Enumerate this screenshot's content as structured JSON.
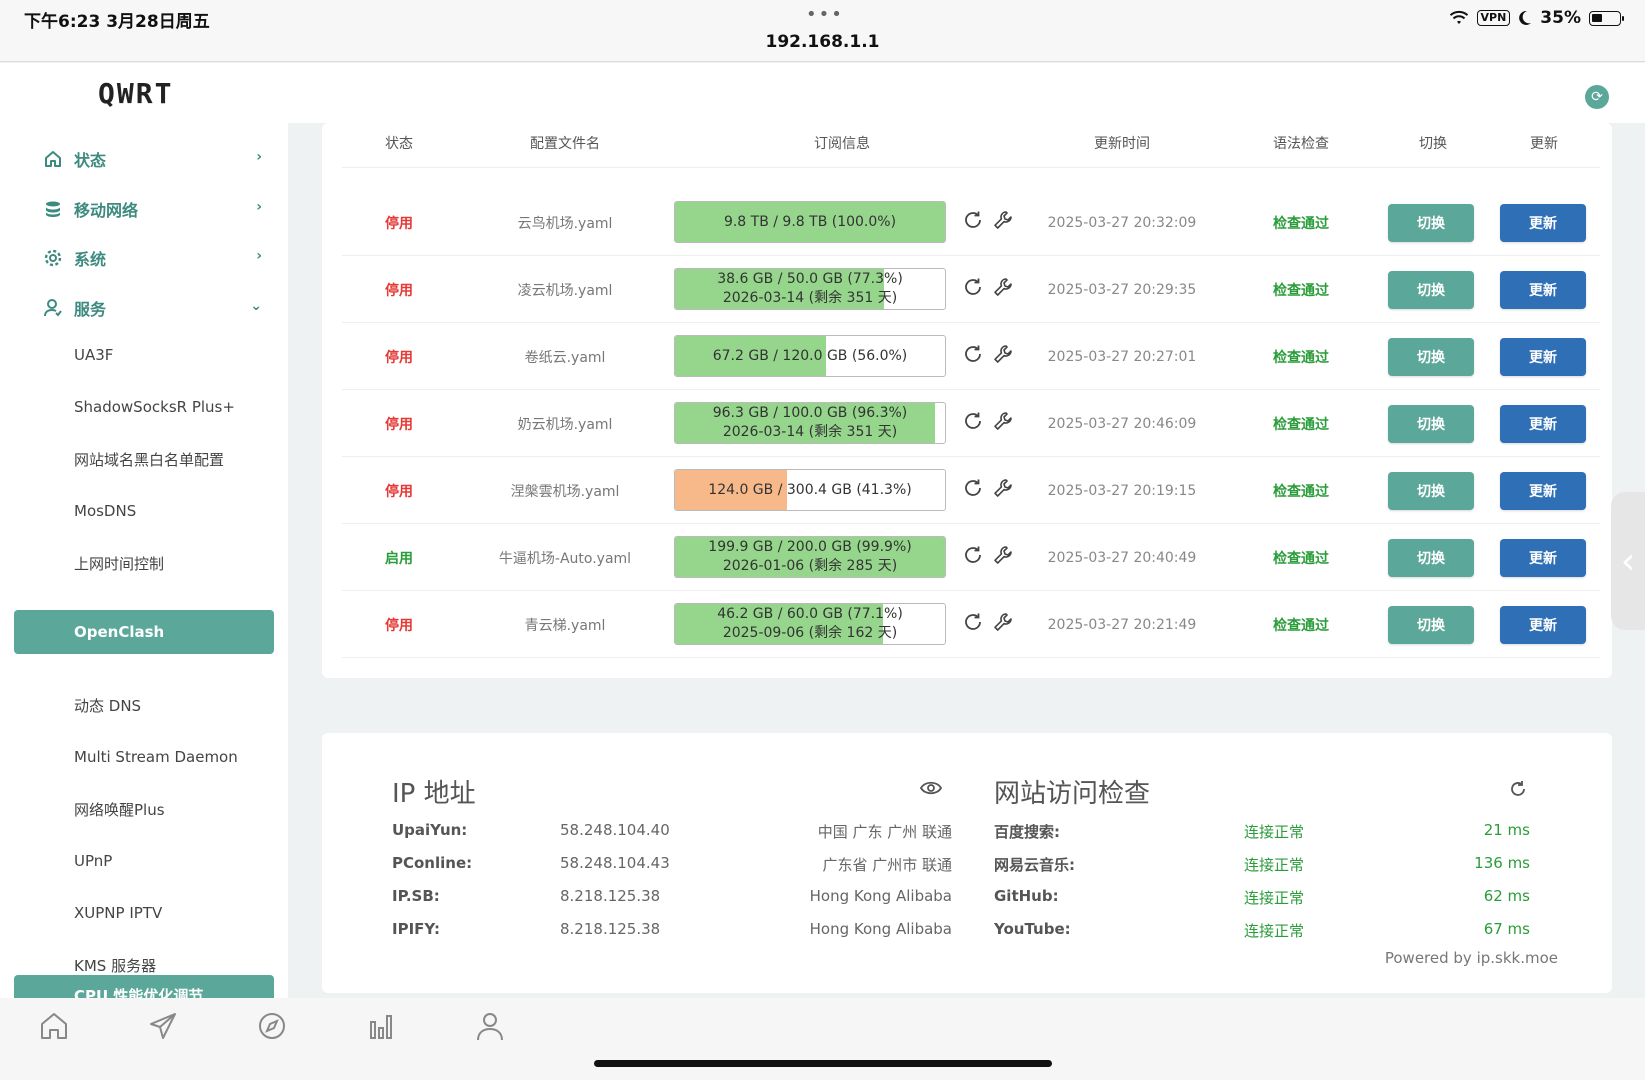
{
  "statusbar": {
    "time": "下午6:23   3月28日周五",
    "dots": "•••",
    "url": "192.168.1.1",
    "vpn": "VPN",
    "battery": "35%"
  },
  "sidebar": {
    "logo": "QWRT",
    "nav": [
      {
        "label": "状态",
        "icon": "home-icon"
      },
      {
        "label": "移动网络",
        "icon": "database-icon"
      },
      {
        "label": "系统",
        "icon": "gear-icon"
      },
      {
        "label": "服务",
        "icon": "user-icon"
      }
    ],
    "sub": [
      "UA3F",
      "ShadowSocksR Plus+",
      "网站域名黑白名单配置",
      "MosDNS",
      "上网时间控制",
      "OpenClash",
      "动态 DNS",
      "Multi Stream Daemon",
      "网络唤醒Plus",
      "UPnP",
      "XUPNP IPTV",
      "KMS 服务器",
      "CPU 性能优化调节"
    ],
    "active": "OpenClash"
  },
  "table": {
    "headers": [
      "状态",
      "配置文件名",
      "订阅信息",
      "更新时间",
      "语法检查",
      "切换",
      "更新"
    ],
    "switch_label": "切换",
    "update_label": "更新",
    "rows": [
      {
        "status": "停用",
        "on": false,
        "file": "云鸟机场.yaml",
        "line1": "9.8 TB / 9.8 TB (100.0%)",
        "line2": "",
        "percent": 100.0,
        "color": "#95d68c",
        "time": "2025-03-27 20:32:09",
        "check": "检查通过"
      },
      {
        "status": "停用",
        "on": false,
        "file": "凌云机场.yaml",
        "line1": "38.6 GB / 50.0 GB (77.3%)",
        "line2": "2026-03-14 (剩余 351 天)",
        "percent": 77.3,
        "color": "#95d68c",
        "time": "2025-03-27 20:29:35",
        "check": "检查通过"
      },
      {
        "status": "停用",
        "on": false,
        "file": "卷纸云.yaml",
        "line1": "67.2 GB / 120.0 GB (56.0%)",
        "line2": "",
        "percent": 56.0,
        "color": "#95d68c",
        "time": "2025-03-27 20:27:01",
        "check": "检查通过"
      },
      {
        "status": "停用",
        "on": false,
        "file": "奶云机场.yaml",
        "line1": "96.3 GB / 100.0 GB (96.3%)",
        "line2": "2026-03-14 (剩余 351 天)",
        "percent": 96.3,
        "color": "#95d68c",
        "time": "2025-03-27 20:46:09",
        "check": "检查通过"
      },
      {
        "status": "停用",
        "on": false,
        "file": "涅槃雲机场.yaml",
        "line1": "124.0 GB / 300.4 GB (41.3%)",
        "line2": "",
        "percent": 41.3,
        "color": "#f8b98a",
        "time": "2025-03-27 20:19:15",
        "check": "检查通过"
      },
      {
        "status": "启用",
        "on": true,
        "file": "牛逼机场-Auto.yaml",
        "line1": "199.9 GB / 200.0 GB (99.9%)",
        "line2": "2026-01-06 (剩余 285 天)",
        "percent": 99.9,
        "color": "#95d68c",
        "time": "2025-03-27 20:40:49",
        "check": "检查通过"
      },
      {
        "status": "停用",
        "on": false,
        "file": "青云梯.yaml",
        "line1": "46.2 GB / 60.0 GB (77.1%)",
        "line2": "2025-09-06 (剩余 162 天)",
        "percent": 77.1,
        "color": "#95d68c",
        "time": "2025-03-27 20:21:49",
        "check": "检查通过"
      }
    ]
  },
  "ip": {
    "title": "IP 地址",
    "rows": [
      {
        "k": "UpaiYun:",
        "v": "58.248.104.40",
        "loc": "中国 广东 广州 联通"
      },
      {
        "k": "PConline:",
        "v": "58.248.104.43",
        "loc": "广东省 广州市 联通"
      },
      {
        "k": "IP.SB:",
        "v": "8.218.125.38",
        "loc": "Hong Kong Alibaba"
      },
      {
        "k": "IPIFY:",
        "v": "8.218.125.38",
        "loc": "Hong Kong Alibaba"
      }
    ]
  },
  "web": {
    "title": "网站访问检查",
    "rows": [
      {
        "k": "百度搜索:",
        "s": "连接正常",
        "ms": "21 ms"
      },
      {
        "k": "网易云音乐:",
        "s": "连接正常",
        "ms": "136 ms"
      },
      {
        "k": "GitHub:",
        "s": "连接正常",
        "ms": "62 ms"
      },
      {
        "k": "YouTube:",
        "s": "连接正常",
        "ms": "67 ms"
      }
    ],
    "powered": "Powered by ip.skk.moe"
  },
  "colors": {
    "accent": "#5ba89a",
    "update": "#2f6fb5",
    "ok": "#2a9d3a",
    "off": "#e53935"
  }
}
